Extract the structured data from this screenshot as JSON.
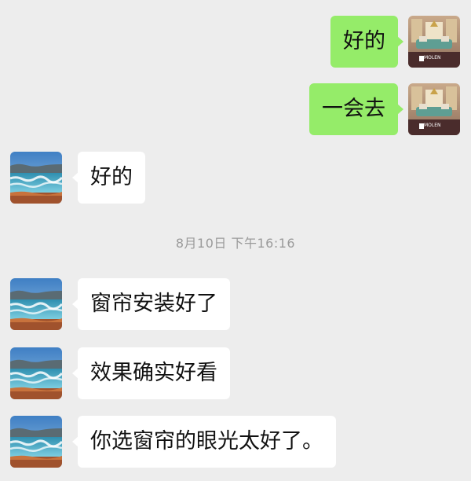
{
  "messages": [
    {
      "side": "me",
      "text": "好的"
    },
    {
      "side": "me",
      "text": "一会去"
    },
    {
      "side": "other",
      "text": "好的"
    },
    {
      "side": "other",
      "text": "窗帘安装好了"
    },
    {
      "side": "other",
      "text": "效果确实好看"
    },
    {
      "side": "other",
      "text": "你选窗帘的眼光太好了。"
    }
  ],
  "timestamp": "8月10日 下午16:16",
  "colors": {
    "background": "#ededed",
    "my_bubble": "#95ec69",
    "other_bubble": "#ffffff",
    "timestamp_text": "#9a9a9a"
  },
  "avatars": {
    "me": {
      "icon": "living-room-photo-avatar",
      "logo_text": "MOLEN"
    },
    "other": {
      "icon": "seascape-photo-avatar"
    }
  }
}
